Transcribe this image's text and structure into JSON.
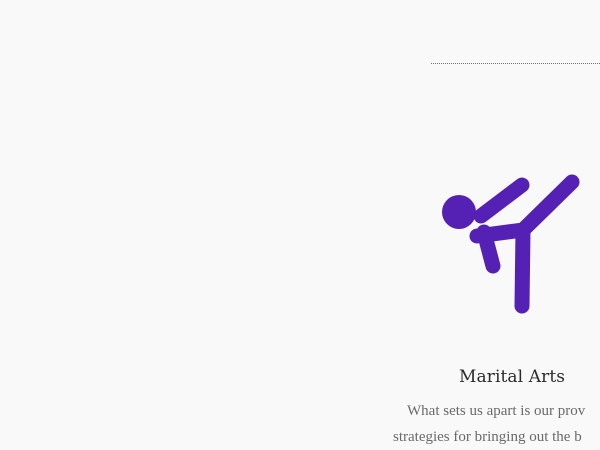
{
  "service": {
    "icon": "martial-arts-kick-icon",
    "icon_color": "#5521b5",
    "title": "Marital Arts",
    "description_lines": [
      "What sets us apart is our prov",
      "strategies for bringing out the b"
    ]
  }
}
